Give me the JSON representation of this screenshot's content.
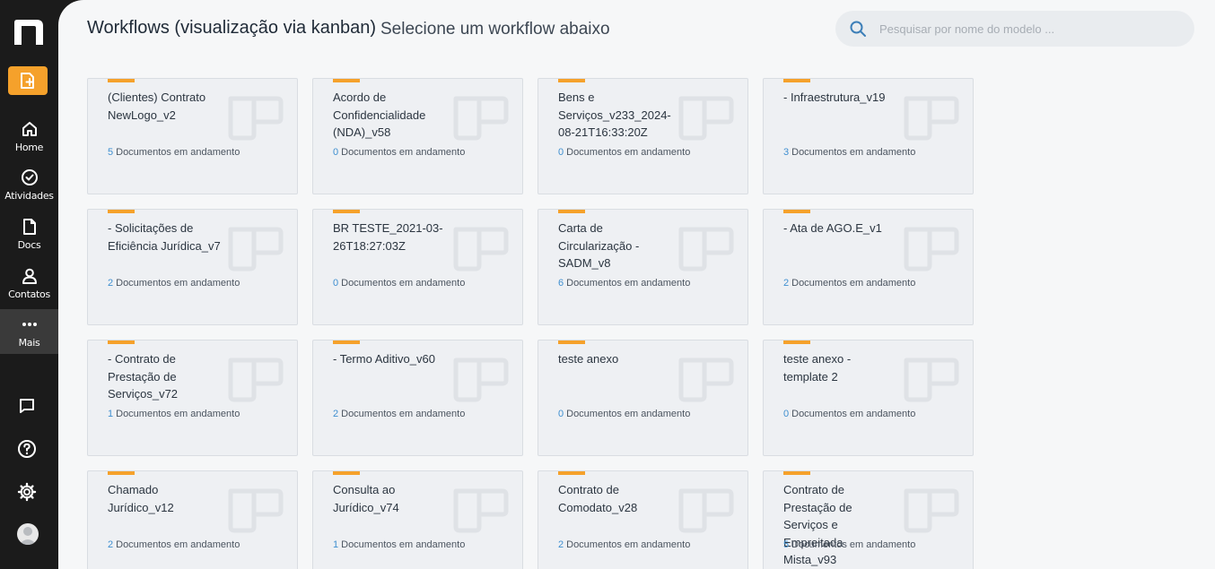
{
  "header": {
    "title": "Workflows (visualização via kanban)",
    "subtitle": "Selecione um workflow abaixo"
  },
  "search": {
    "placeholder": "Pesquisar por nome do modelo ..."
  },
  "sidebar": {
    "items": [
      {
        "label": "Home",
        "icon": "home-icon"
      },
      {
        "label": "Atividades",
        "icon": "check-circle-icon"
      },
      {
        "label": "Docs",
        "icon": "document-icon"
      },
      {
        "label": "Contatos",
        "icon": "user-icon"
      },
      {
        "label": "Mais",
        "icon": "more-dots-icon"
      }
    ]
  },
  "accent_color": "#f5a12b",
  "count_suffix": "Documentos em andamento",
  "workflows": [
    {
      "title": "(Clientes) Contrato NewLogo_v2",
      "count": "5"
    },
    {
      "title": "Acordo de Confidencialidade (NDA)_v58",
      "count": "0"
    },
    {
      "title": "Bens e Serviços_v233_2024-08-21T16:33:20Z",
      "count": "0"
    },
    {
      "title": "- Infraestrutura_v19",
      "count": "3"
    },
    {
      "title": "- Solicitações de Eficiência Jurídica_v7",
      "count": "2"
    },
    {
      "title": "BR TESTE_2021-03-26T18:27:03Z",
      "count": "0"
    },
    {
      "title": "Carta de Circularização - SADM_v8",
      "count": "6"
    },
    {
      "title": "- Ata de AGO.E_v1",
      "count": "2"
    },
    {
      "title": "- Contrato de Prestação de Serviços_v72",
      "count": "1"
    },
    {
      "title": "- Termo Aditivo_v60",
      "count": "2"
    },
    {
      "title": "teste anexo",
      "count": "0"
    },
    {
      "title": "teste anexo - template 2",
      "count": "0"
    },
    {
      "title": "Chamado Jurídico_v12",
      "count": "2"
    },
    {
      "title": "Consulta ao Jurídico_v74",
      "count": "1"
    },
    {
      "title": "Contrato de Comodato_v28",
      "count": "2"
    },
    {
      "title": "Contrato de Prestação de Serviços e Empreitada Mista_v93",
      "count": "5"
    }
  ]
}
